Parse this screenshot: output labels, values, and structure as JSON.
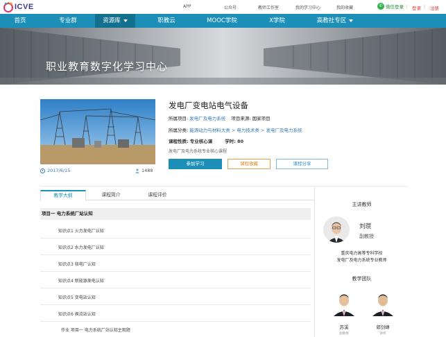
{
  "topbar": {
    "logo_text": "ICVE",
    "links": [
      "APP",
      "公众号",
      "教师工作室",
      "我的学习中心",
      "我的收藏"
    ],
    "wechat_login": "微信登录",
    "login": "登录",
    "register": "注册",
    "separator": "|"
  },
  "nav": {
    "items": [
      {
        "label": "首页"
      },
      {
        "label": "专业群"
      },
      {
        "label": "资源库"
      },
      {
        "label": "职教云"
      },
      {
        "label": "MOOC学院"
      },
      {
        "label": "X学院"
      },
      {
        "label": "高教社专区"
      }
    ],
    "active_index": 2
  },
  "banner": {
    "title": "职业教育数字化学习中心"
  },
  "course": {
    "title": "发电厂变电站电气设备",
    "project_label": "所属项目:",
    "project_value": "发电厂及电力系统",
    "source_label": "项目来源:",
    "source_value": "国家项目",
    "category_label": "所属分类:",
    "category_value": "能源动力与材料大类 > 电力技术类 > 发电厂及电力系统",
    "nature_label": "课程性质:",
    "nature_value": "专业核心课",
    "hours_label": "学时:",
    "hours_value": "80",
    "description": "发电厂及电力系统专业核心课程",
    "date": "2017/6/15",
    "views": "1488",
    "join_button": "参加学习",
    "favorite_button": "课程收藏",
    "share_button": "课程分享"
  },
  "tabs": [
    {
      "label": "教学大纲"
    },
    {
      "label": "课程简介"
    },
    {
      "label": "课程评价"
    }
  ],
  "syllabus": {
    "section_title": "项目一 电力系统厂站认知",
    "points": [
      "知识点1 火力发电厂认知",
      "知识点2 水力发电厂认知",
      "知识点3 核电厂认知",
      "知识点4 新能源发电认知",
      "知识点5 变电站认知",
      "知识点6 换流站认知"
    ],
    "task": "作业  项目一 电力系统厂站认知主观题"
  },
  "sidebar": {
    "lead_title": "主讲教师",
    "teacher_name": "刘瓒",
    "teacher_rank": "副教授",
    "teacher_school": "重庆电力高等专科学校",
    "teacher_dept": "发电厂及电力系统专业教师",
    "team_title": "教学团队",
    "members": [
      {
        "name": "苏溪",
        "sub": "副教授"
      },
      {
        "name": "郭剑峰",
        "sub": "讲师"
      }
    ]
  },
  "colors": {
    "nav": "#1b8fb8",
    "nav_active": "#14708f",
    "link": "#3579b8",
    "favorite": "#e08a1c"
  }
}
